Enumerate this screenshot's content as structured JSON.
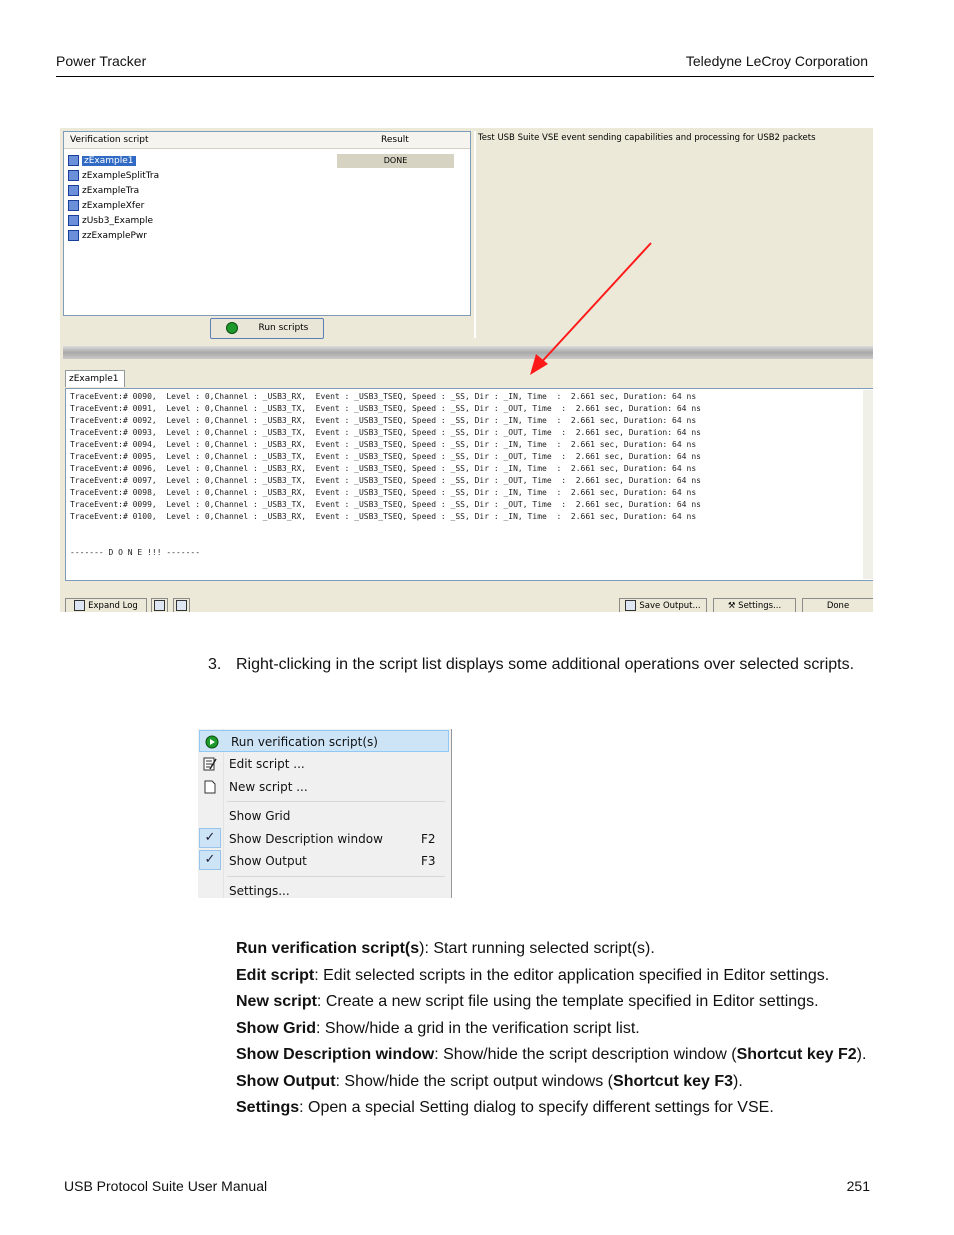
{
  "header": {
    "left": "Power Tracker",
    "right": "Teledyne LeCroy Corporation"
  },
  "footer": {
    "left": "USB Protocol Suite User Manual",
    "right": "251"
  },
  "screenshot1": {
    "col_script": "Verification script",
    "col_result": "Result",
    "scripts": [
      "zExample1",
      "zExampleSplitTra",
      "zExampleTra",
      "zExampleXfer",
      "zUsb3_Example",
      "zzExamplePwr"
    ],
    "first_result": "DONE",
    "description": "Test USB Suite VSE event sending capabilities and processing for USB2 packets",
    "run_button": "Run scripts",
    "tab": "zExample1",
    "output_lines": [
      "TraceEvent:# 0090,  Level : 0,Channel : _USB3_RX,  Event : _USB3_TSEQ, Speed : _SS, Dir : _IN, Time  :  2.661 sec, Duration: 64 ns",
      "TraceEvent:# 0091,  Level : 0,Channel : _USB3_TX,  Event : _USB3_TSEQ, Speed : _SS, Dir : _OUT, Time  :  2.661 sec, Duration: 64 ns",
      "TraceEvent:# 0092,  Level : 0,Channel : _USB3_RX,  Event : _USB3_TSEQ, Speed : _SS, Dir : _IN, Time  :  2.661 sec, Duration: 64 ns",
      "TraceEvent:# 0093,  Level : 0,Channel : _USB3_TX,  Event : _USB3_TSEQ, Speed : _SS, Dir : _OUT, Time  :  2.661 sec, Duration: 64 ns",
      "TraceEvent:# 0094,  Level : 0,Channel : _USB3_RX,  Event : _USB3_TSEQ, Speed : _SS, Dir : _IN, Time  :  2.661 sec, Duration: 64 ns",
      "TraceEvent:# 0095,  Level : 0,Channel : _USB3_TX,  Event : _USB3_TSEQ, Speed : _SS, Dir : _OUT, Time  :  2.661 sec, Duration: 64 ns",
      "TraceEvent:# 0096,  Level : 0,Channel : _USB3_RX,  Event : _USB3_TSEQ, Speed : _SS, Dir : _IN, Time  :  2.661 sec, Duration: 64 ns",
      "TraceEvent:# 0097,  Level : 0,Channel : _USB3_TX,  Event : _USB3_TSEQ, Speed : _SS, Dir : _OUT, Time  :  2.661 sec, Duration: 64 ns",
      "TraceEvent:# 0098,  Level : 0,Channel : _USB3_RX,  Event : _USB3_TSEQ, Speed : _SS, Dir : _IN, Time  :  2.661 sec, Duration: 64 ns",
      "TraceEvent:# 0099,  Level : 0,Channel : _USB3_TX,  Event : _USB3_TSEQ, Speed : _SS, Dir : _OUT, Time  :  2.661 sec, Duration: 64 ns",
      "TraceEvent:# 0100,  Level : 0,Channel : _USB3_RX,  Event : _USB3_TSEQ, Speed : _SS, Dir : _IN, Time  :  2.661 sec, Duration: 64 ns"
    ],
    "done_line": "------- D O N E !!! -------",
    "expand_log": "Expand Log",
    "save_output": "Save Output...",
    "settings": "Settings...",
    "done": "Done"
  },
  "step": {
    "number": "3.",
    "text": "Right-clicking in the script list displays some additional operations over selected scripts."
  },
  "menu": {
    "run": "Run verification script(s)",
    "edit": "Edit script ...",
    "new": "New script ...",
    "grid": "Show Grid",
    "desc": "Show Description window",
    "desc_key": "F2",
    "output": "Show Output",
    "output_key": "F3",
    "settings": "Settings..."
  },
  "defs": {
    "run_term": "Run verification script(s",
    "run_text": "): Start running selected script(s).",
    "edit_term": "Edit script",
    "edit_text": ": Edit selected scripts in the editor application specified in Editor settings.",
    "new_term": "New script",
    "new_text": ": Create a new script file using the template specified in Editor settings.",
    "grid_term": "Show Grid",
    "grid_text": ": Show/hide a grid in the verification script list.",
    "desc_term": "Show Description window",
    "desc_text": ": Show/hide the script description window (",
    "desc_key": "Shortcut key F2",
    "desc_end": ").",
    "out_term": "Show Output",
    "out_text": ": Show/hide the script output windows (",
    "out_key": "Shortcut key F3",
    "out_end": ").",
    "settings_term": "Settings",
    "settings_text": ": Open a special Setting dialog to specify different settings for VSE."
  }
}
